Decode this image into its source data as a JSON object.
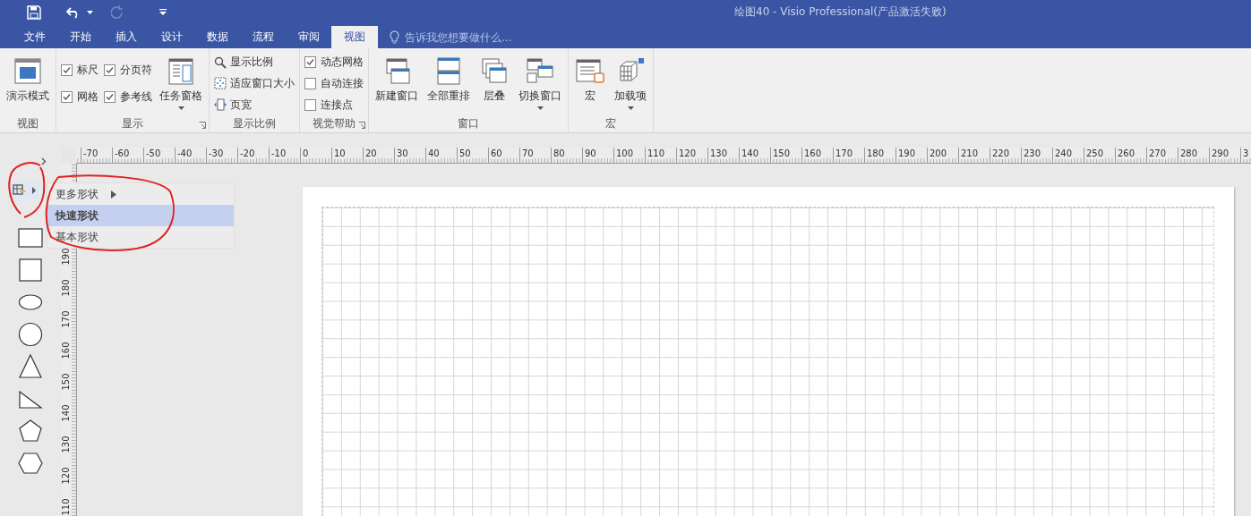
{
  "title_bar": {
    "title": "绘图40 - Visio Professional(产品激活失败)"
  },
  "tabs": [
    {
      "label": "文件",
      "selected": false
    },
    {
      "label": "开始",
      "selected": false
    },
    {
      "label": "插入",
      "selected": false
    },
    {
      "label": "设计",
      "selected": false
    },
    {
      "label": "数据",
      "selected": false
    },
    {
      "label": "流程",
      "selected": false
    },
    {
      "label": "审阅",
      "selected": false
    },
    {
      "label": "视图",
      "selected": true
    }
  ],
  "tell_me": {
    "placeholder": "告诉我您想要做什么..."
  },
  "ribbon": [
    {
      "name": "视图",
      "launcher": false,
      "columns": [
        [
          {
            "kind": "large",
            "label": "演示模式",
            "dropdown": false
          }
        ]
      ]
    },
    {
      "name": "显示",
      "launcher": true,
      "columns": [
        [
          {
            "kind": "check",
            "label": "标尺",
            "checked": true
          },
          {
            "kind": "check",
            "label": "网格",
            "checked": true
          }
        ],
        [
          {
            "kind": "check",
            "label": "分页符",
            "checked": true
          },
          {
            "kind": "check",
            "label": "参考线",
            "checked": true
          }
        ],
        [
          {
            "kind": "large",
            "label": "任务窗格",
            "dropdown": true
          }
        ]
      ]
    },
    {
      "name": "显示比例",
      "launcher": false,
      "columns": [
        [
          {
            "kind": "small",
            "label": "显示比例"
          },
          {
            "kind": "small",
            "label": "适应窗口大小"
          },
          {
            "kind": "small",
            "label": "页宽"
          }
        ]
      ]
    },
    {
      "name": "视觉帮助",
      "launcher": true,
      "columns": [
        [
          {
            "kind": "check",
            "label": "动态网格",
            "checked": true
          },
          {
            "kind": "check",
            "label": "自动连接",
            "checked": false
          },
          {
            "kind": "check",
            "label": "连接点",
            "checked": false
          }
        ]
      ]
    },
    {
      "name": "窗口",
      "launcher": false,
      "columns": [
        [
          {
            "kind": "large",
            "label": "新建窗口",
            "dropdown": false
          }
        ],
        [
          {
            "kind": "large",
            "label": "全部重排",
            "dropdown": false
          }
        ],
        [
          {
            "kind": "large",
            "label": "层叠",
            "dropdown": false
          }
        ],
        [
          {
            "kind": "large",
            "label": "切换窗口",
            "dropdown": true
          }
        ]
      ]
    },
    {
      "name": "宏",
      "launcher": false,
      "columns": [
        [
          {
            "kind": "large",
            "label": "宏",
            "dropdown": false
          }
        ],
        [
          {
            "kind": "large",
            "label": "加载项",
            "dropdown": true
          }
        ]
      ]
    }
  ],
  "horizontal_ruler": [
    "-70",
    "-60",
    "-50",
    "-40",
    "-30",
    "-20",
    "-10",
    "0",
    "10",
    "20",
    "30",
    "40",
    "50",
    "60",
    "70",
    "80",
    "90",
    "100",
    "110",
    "120",
    "130",
    "140",
    "150",
    "160",
    "170",
    "180",
    "190",
    "200",
    "210",
    "220",
    "230",
    "240",
    "250",
    "260",
    "270",
    "280",
    "290",
    "3"
  ],
  "vertical_ruler": [
    "190",
    "180",
    "170",
    "160",
    "150",
    "140",
    "130",
    "120",
    "110"
  ],
  "shapes_menu": {
    "more_shapes": "更多形状",
    "stencils": [
      {
        "label": "快速形状",
        "selected": true
      },
      {
        "label": "基本形状",
        "selected": false
      }
    ]
  },
  "shapes": [
    {
      "kind": "rectangle"
    },
    {
      "kind": "square"
    },
    {
      "kind": "ellipse"
    },
    {
      "kind": "circle"
    },
    {
      "kind": "triangle"
    },
    {
      "kind": "right-triangle"
    },
    {
      "kind": "pentagon"
    },
    {
      "kind": "hexagon"
    }
  ]
}
